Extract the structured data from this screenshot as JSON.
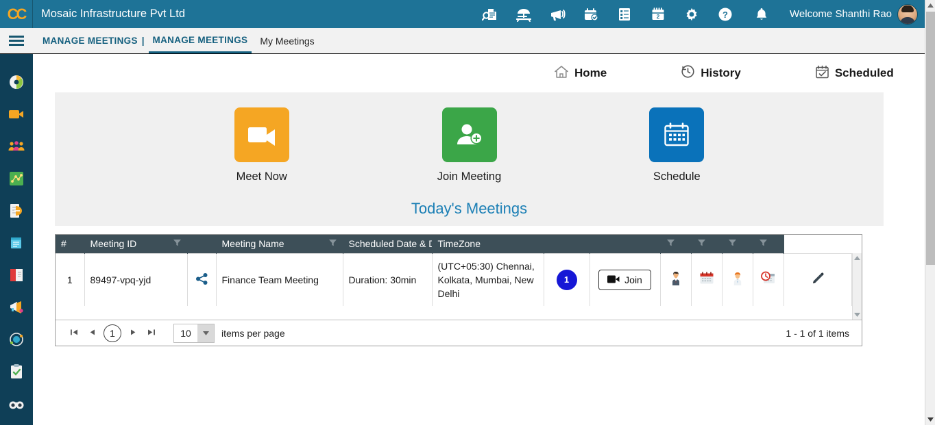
{
  "topbar": {
    "logo": "CC",
    "logo_icon": "cc-logo-icon",
    "org_title": "Mosaic Infrastructure Pvt Ltd",
    "welcome": "Welcome Shanthi Rao",
    "bg_color": "#1e7397",
    "icons": [
      {
        "name": "document-search-icon",
        "title": "Search Documents"
      },
      {
        "name": "beach-umbrella-icon",
        "title": "Leave"
      },
      {
        "name": "megaphone-icon",
        "title": "Announcements"
      },
      {
        "name": "calendar-check-icon",
        "title": "Approvals"
      },
      {
        "name": "checklist-icon",
        "title": "Tasks"
      },
      {
        "name": "calendar-day-icon",
        "title": "Calendar"
      },
      {
        "name": "gear-icon",
        "title": "Settings"
      },
      {
        "name": "help-circle-icon",
        "title": "Help"
      },
      {
        "name": "bell-icon",
        "title": "Notifications"
      }
    ]
  },
  "navbar": {
    "menu_icon": "hamburger-menu-icon",
    "breadcrumb_root": "MANAGE MEETINGS",
    "breadcrumb_sep": "|",
    "breadcrumb_active": "MANAGE MEETINGS",
    "tab_my_meetings": "My Meetings"
  },
  "sidebar": {
    "bg_color": "#0f3f57",
    "items": [
      {
        "name": "sidebar-item-dashboard",
        "icon": "pie-chart-icon"
      },
      {
        "name": "sidebar-item-meetings",
        "icon": "video-camera-icon"
      },
      {
        "name": "sidebar-item-teams",
        "icon": "people-group-icon"
      },
      {
        "name": "sidebar-item-network",
        "icon": "network-map-icon"
      },
      {
        "name": "sidebar-item-documents",
        "icon": "document-pen-icon"
      },
      {
        "name": "sidebar-item-notes",
        "icon": "notepad-icon"
      },
      {
        "name": "sidebar-item-reports",
        "icon": "red-book-icon"
      },
      {
        "name": "sidebar-item-announcements",
        "icon": "horn-icon"
      },
      {
        "name": "sidebar-item-settings",
        "icon": "orbit-icon"
      },
      {
        "name": "sidebar-item-tasks",
        "icon": "clipboard-check-icon"
      },
      {
        "name": "sidebar-item-more",
        "icon": "binoculars-icon"
      }
    ]
  },
  "quicknav": [
    {
      "label": "Home",
      "icon": "home-icon"
    },
    {
      "label": "History",
      "icon": "clock-history-icon"
    },
    {
      "label": "Scheduled",
      "icon": "calendar-scheduled-icon"
    }
  ],
  "tiles": [
    {
      "label": "Meet Now",
      "icon": "video-camera-icon",
      "color": "#f5a623"
    },
    {
      "label": "Join Meeting",
      "icon": "person-add-icon",
      "color": "#3ba648"
    },
    {
      "label": "Schedule",
      "icon": "calendar-icon",
      "color": "#0a72ba"
    }
  ],
  "section_title": "Today's Meetings",
  "table": {
    "columns": [
      {
        "label": "#",
        "filter": false
      },
      {
        "label": "Meeting ID",
        "filter": true
      },
      {
        "label": "",
        "filter": false
      },
      {
        "label": "Meeting Name",
        "filter": true
      },
      {
        "label": "Scheduled Date & D...",
        "filter": false
      },
      {
        "label": "TimeZone",
        "filter": false
      },
      {
        "label": "",
        "filter": false
      },
      {
        "label": "",
        "filter": false
      },
      {
        "label": "",
        "filter": true
      },
      {
        "label": "",
        "filter": true
      },
      {
        "label": "",
        "filter": true
      },
      {
        "label": "",
        "filter": true
      }
    ],
    "rows": [
      {
        "index": "1",
        "meeting_id": "89497-vpq-yjd",
        "share_icon": "share-icon",
        "meeting_name": "Finance Team Meeting",
        "duration": "Duration: 30min",
        "timezone": "(UTC+05:30) Chennai, Kolkata, Mumbai, New Delhi",
        "attendee_count": "1",
        "join_label": "Join",
        "join_icon": "video-camera-icon",
        "actions": [
          {
            "name": "attendees-icon",
            "icon": "person-suit-icon"
          },
          {
            "name": "reschedule-calendar-icon",
            "icon": "calendar-red-icon"
          },
          {
            "name": "host-icon",
            "icon": "person-orange-icon"
          },
          {
            "name": "cancel-meeting-icon",
            "icon": "calendar-clock-icon"
          },
          {
            "name": "edit-meeting-icon",
            "icon": "pencil-icon"
          }
        ]
      }
    ]
  },
  "pager": {
    "first_icon": "page-first-icon",
    "prev_icon": "page-prev-icon",
    "current_page": "1",
    "next_icon": "page-next-icon",
    "last_icon": "page-last-icon",
    "page_size": "10",
    "items_per_page_label": "items per page",
    "range_label": "1 - 1 of 1 items"
  }
}
